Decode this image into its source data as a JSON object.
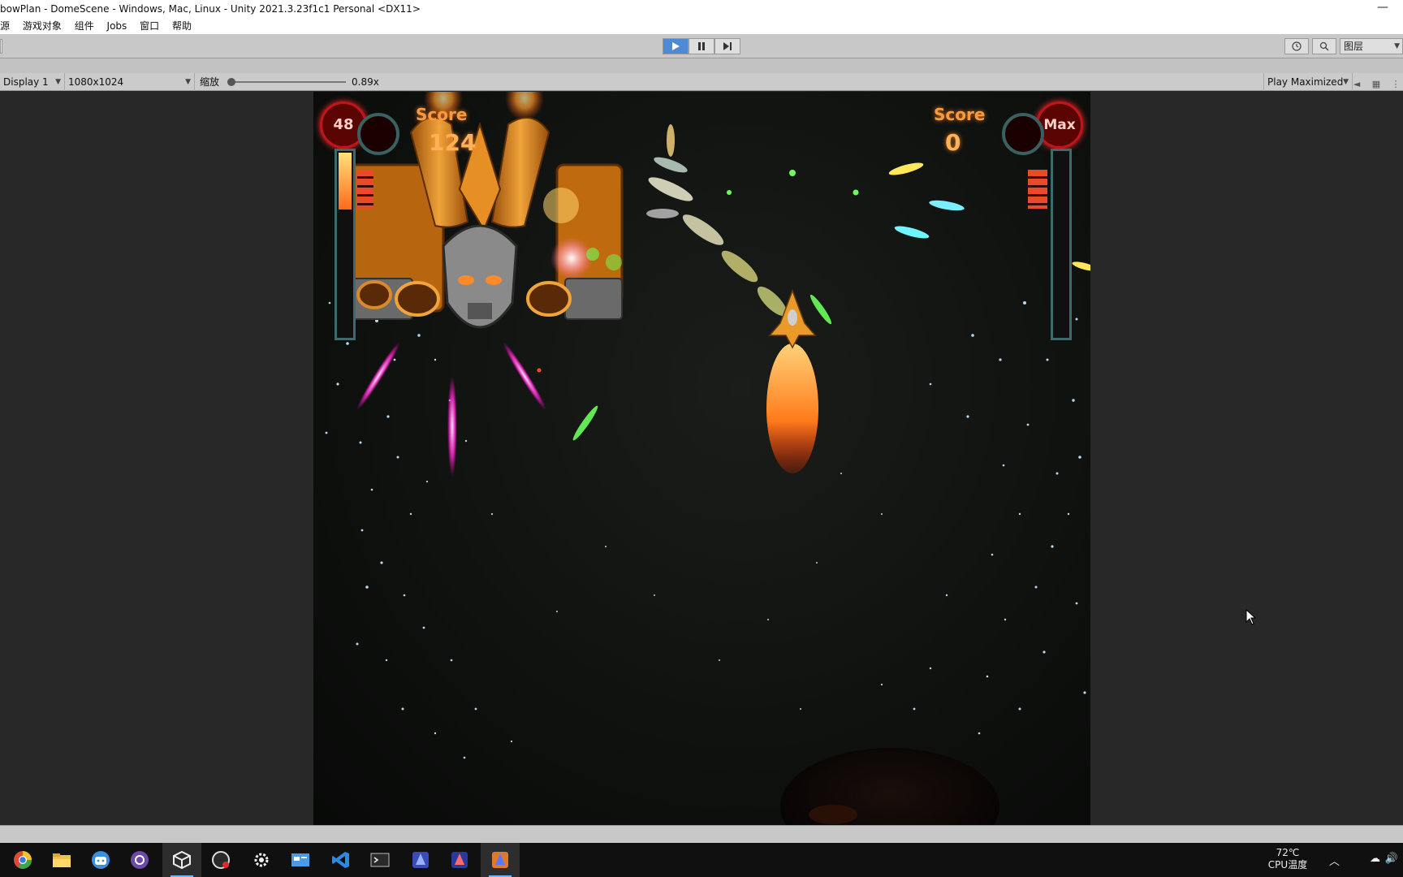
{
  "window": {
    "title": "bowPlan - DomeScene - Windows, Mac, Linux - Unity 2021.3.23f1c1 Personal <DX11>",
    "minimize_glyph": "—"
  },
  "menu": [
    "源",
    "游戏对象",
    "组件",
    "Jobs",
    "窗口",
    "帮助"
  ],
  "toolbar": {
    "play": "play-icon",
    "pause": "pause-icon",
    "step": "step-icon",
    "layers_label": "图层"
  },
  "gameview": {
    "display": "Display 1",
    "resolution": "1080x1024",
    "scale_label": "缩放",
    "scale_value": "0.89x",
    "play_mode": "Play Maximized",
    "scale_fraction": 0.0
  },
  "hud": {
    "left_level": "48",
    "left_score_label": "Score",
    "left_score": "124",
    "right_level": "Max",
    "right_score_label": "Score",
    "right_score": "0"
  },
  "taskbar": {
    "apps": [
      "chrome-icon",
      "file-explorer-icon",
      "bilibili-icon",
      "github-icon",
      "unity-icon",
      "obs-icon",
      "settings-icon",
      "app-window-icon",
      "vscode-icon",
      "terminal-icon",
      "game-app-1-icon",
      "game-app-2-icon",
      "game-app-3-icon"
    ],
    "active_index": 12,
    "temp": "72℃",
    "temp_label": "CPU温度"
  },
  "colors": {
    "play_active": "#4d8bd6",
    "hud_text": "#ff9a3c",
    "hud_ring": "#c0151b"
  }
}
